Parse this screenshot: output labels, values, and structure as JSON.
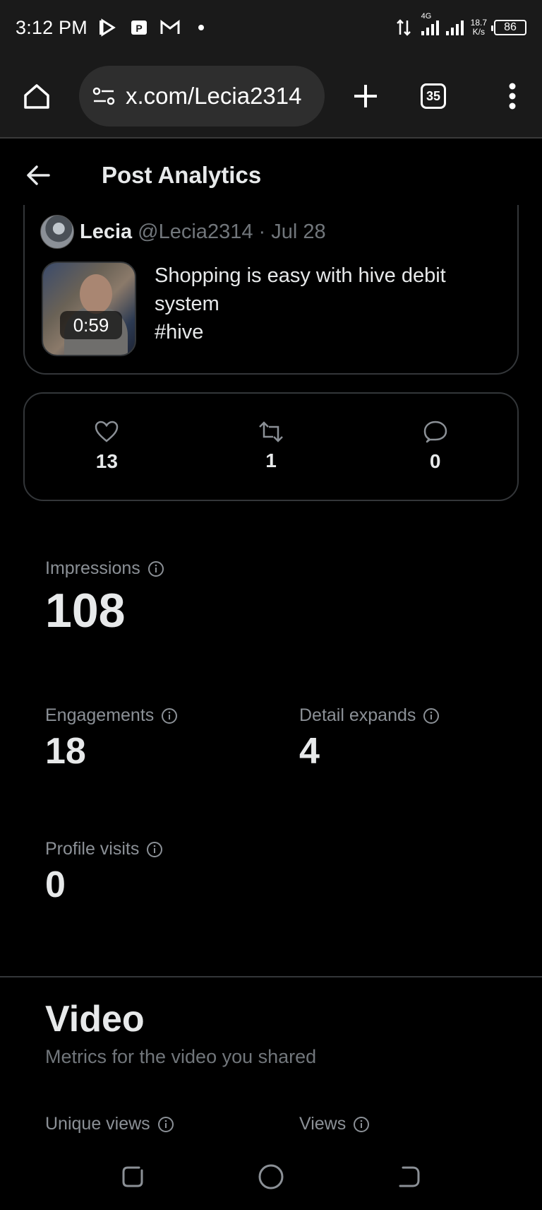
{
  "status_bar": {
    "time": "3:12 PM",
    "network_type": "4G",
    "speed_value": "18.7",
    "speed_unit": "K/s",
    "battery": "86"
  },
  "browser": {
    "url": "x.com/Lecia2314",
    "tab_count": "35"
  },
  "header": {
    "title": "Post Analytics"
  },
  "post": {
    "author_name": "Lecia",
    "author_meta": "@Lecia2314 · Jul 28",
    "video_duration": "0:59",
    "text": "Shopping is easy with hive debit system\n#hive"
  },
  "engagement_counts": {
    "likes": "13",
    "reposts": "1",
    "replies": "0"
  },
  "stats": {
    "impressions": {
      "label": "Impressions",
      "value": "108"
    },
    "engagements": {
      "label": "Engagements",
      "value": "18"
    },
    "detail_expands": {
      "label": "Detail expands",
      "value": "4"
    },
    "profile_visits": {
      "label": "Profile visits",
      "value": "0"
    }
  },
  "video_section": {
    "title": "Video",
    "subtitle": "Metrics for the video you shared",
    "unique_views_label": "Unique views",
    "views_label": "Views"
  },
  "colors": {
    "background": "#000000",
    "text_primary": "#e7e9ea",
    "text_secondary": "#71767b",
    "border": "#333639",
    "browser_bar": "#1a1a1a"
  }
}
